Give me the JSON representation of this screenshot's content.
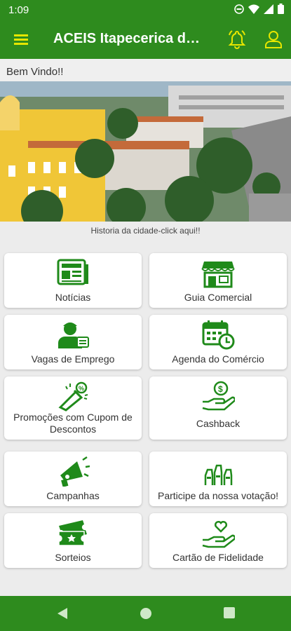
{
  "status": {
    "time": "1:09"
  },
  "appbar": {
    "title": "ACEIS Itapecerica da Serra",
    "menu_icon": "menu-icon",
    "bell_icon": "bell-icon",
    "user_icon": "user-icon"
  },
  "welcome": "Bem Vindo!!",
  "history_link": "Historia da cidade-click aqui!!",
  "menu": [
    {
      "label": "Notícias",
      "icon": "newspaper-icon"
    },
    {
      "label": "Guia Comercial",
      "icon": "store-icon"
    },
    {
      "label": "Vagas de Emprego",
      "icon": "worker-icon"
    },
    {
      "label": "Agenda do Comércio",
      "icon": "calendar-clock-icon"
    },
    {
      "label": "Promoções com Cupom de Descontos",
      "icon": "coupon-icon"
    },
    {
      "label": "Cashback",
      "icon": "cashback-icon"
    },
    {
      "label": "Campanhas",
      "icon": "megaphone-icon"
    },
    {
      "label": "Participe da nossa votação!",
      "icon": "voting-hands-icon"
    },
    {
      "label": "Sorteios",
      "icon": "ticket-icon"
    },
    {
      "label": "Cartão de Fidelidade",
      "icon": "heart-hand-icon"
    }
  ],
  "colors": {
    "primary": "#2e8b1e",
    "accent": "#e6e600",
    "icon": "#1f8a1a"
  }
}
